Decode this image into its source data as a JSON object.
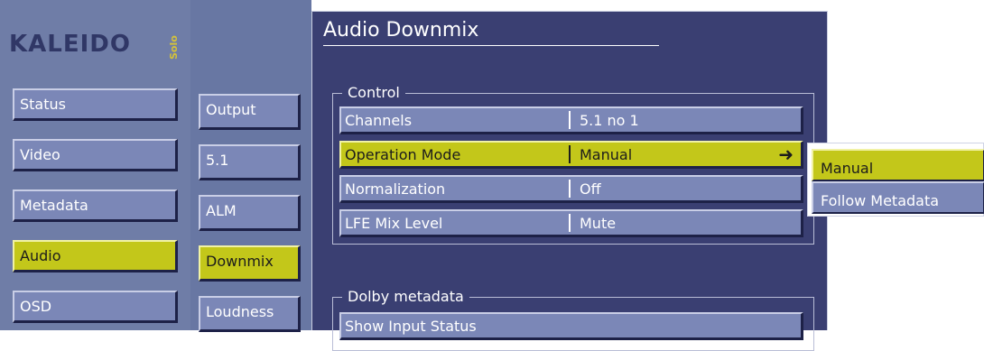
{
  "logo": {
    "brand": "KALEIDO",
    "edition": "Solo"
  },
  "nav": [
    "Status",
    "Video",
    "Metadata",
    "Audio",
    "OSD"
  ],
  "subnav": [
    "Output",
    "5.1",
    "ALM",
    "Downmix",
    "Loudness"
  ],
  "page": {
    "title": "Audio Downmix"
  },
  "control": {
    "label": "Control",
    "rows": [
      {
        "label": "Channels",
        "value": "5.1 no 1"
      },
      {
        "label": "Operation Mode",
        "value": "Manual"
      },
      {
        "label": "Normalization",
        "value": "Off"
      },
      {
        "label": "LFE Mix Level",
        "value": "Mute"
      }
    ]
  },
  "dolby": {
    "label": "Dolby metadata",
    "rows": [
      {
        "label": "Show Input Status"
      }
    ]
  },
  "popup": {
    "options": [
      "Manual",
      "Follow Metadata"
    ]
  },
  "colors": {
    "accent": "#c3c71a",
    "button": "#7b87b7",
    "panel": "#3a3f72",
    "sidebar": "#6f7da7"
  },
  "icons": {
    "submenu": "right-arrow-icon"
  }
}
